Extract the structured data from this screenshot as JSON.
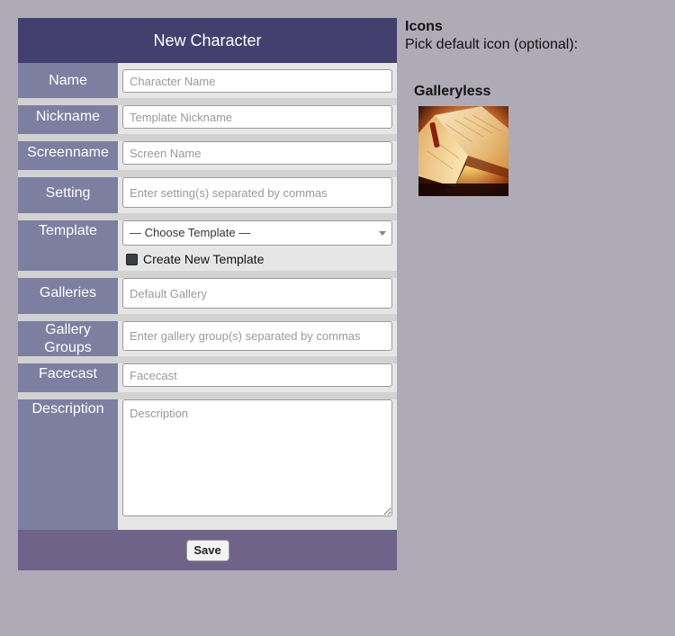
{
  "form": {
    "title": "New Character",
    "fields": {
      "name": {
        "label": "Name",
        "placeholder": "Character Name"
      },
      "nickname": {
        "label": "Nickname",
        "placeholder": "Template Nickname"
      },
      "screenname": {
        "label": "Screenname",
        "placeholder": "Screen Name"
      },
      "setting": {
        "label": "Setting",
        "placeholder": "Enter setting(s) separated by commas"
      },
      "template": {
        "label": "Template",
        "selected": "— Choose Template —",
        "create_new_label": "Create New Template"
      },
      "galleries": {
        "label": "Galleries",
        "placeholder": "Default Gallery"
      },
      "gallery_groups": {
        "label_line1": "Gallery",
        "label_line2": "Groups",
        "placeholder": "Enter gallery group(s) separated by commas"
      },
      "facecast": {
        "label": "Facecast",
        "placeholder": "Facecast"
      },
      "description": {
        "label": "Description",
        "placeholder": "Description"
      }
    },
    "save_label": "Save"
  },
  "icons": {
    "title": "Icons",
    "subtitle": "Pick default icon (optional):",
    "gallery_name": "Galleryless",
    "thumbnail_icon": "open-book-icon"
  },
  "colors": {
    "page_bg": "#aeabb6",
    "header_bg": "#433f6e",
    "label_col_bg": "#7c7fa0",
    "footer_bg": "#6f6389"
  }
}
